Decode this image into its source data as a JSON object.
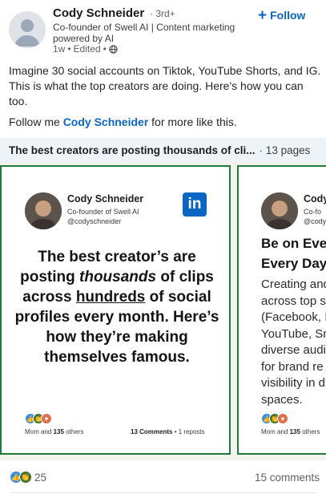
{
  "post": {
    "author": "Cody Schneider",
    "degree": "· 3rd+",
    "headline": "Co-founder of Swell AI | Content marketing powered by AI",
    "time": "1w",
    "edited": "Edited",
    "follow_label": "Follow",
    "text": "Imagine 30 social accounts on Tiktok, YouTube Shorts, and IG. This is what the top creators are doing. Here's how you can too.",
    "follow_prefix": "Follow me",
    "follow_link": "Cody Schneider",
    "follow_suffix": "for more like this."
  },
  "document": {
    "title": "The best creators are posting thousands of cli...",
    "pages": "· 13 pages"
  },
  "slides": [
    {
      "name": "Cody Schneider",
      "sub1": "Co-founder of Swell AI",
      "sub2": "@codyschneider",
      "logo": "in",
      "body_1": "The best creator’s are posting",
      "body_em": "thousands",
      "body_2": "of clips across",
      "body_u": "hundreds",
      "body_3": "of social profiles every month. Here’s how they’re making themselves famous.",
      "react_name": "Mom",
      "react_and": "and",
      "react_count": "135",
      "react_others": "others",
      "comments": "13 Comments",
      "reposts": "• 1 reposts"
    },
    {
      "name": "Cody",
      "sub1": "Co-fo",
      "sub2": "@cody",
      "title_1": "Be on Eve",
      "title_2": "Every Day",
      "lines": [
        "Creating and",
        "across top s",
        "(Facebook, I",
        "YouTube, Sn",
        "diverse audi",
        "for brand re",
        "visibility in d",
        "spaces."
      ],
      "react_name": "Mom",
      "react_and": "and",
      "react_count": "135",
      "react_others": "others"
    }
  ],
  "social": {
    "reaction_count": "25",
    "comments": "15 comments"
  },
  "icons": {
    "like": "thumbs-up-icon",
    "celebrate": "clapping-hands-icon",
    "love": "heart-icon",
    "globe": "globe-icon"
  },
  "colors": {
    "accent": "#0a66c2",
    "slide_border": "#1f7a3a",
    "doc_bar": "#eef3f8"
  }
}
